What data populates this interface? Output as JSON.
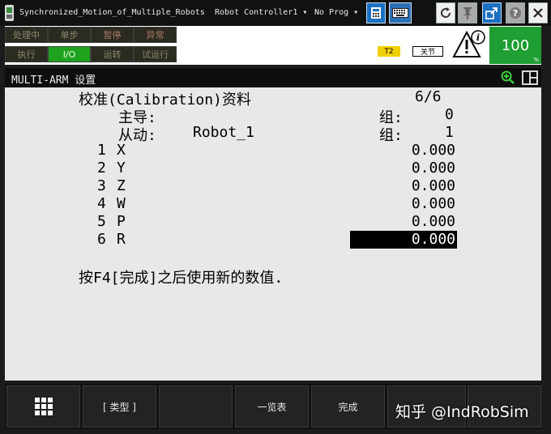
{
  "window": {
    "title": "Synchronized_Motion_of_Multiple_Robots",
    "controller": "Robot Controller1",
    "program": "No Prog"
  },
  "status_panel": {
    "row1": [
      "处理中",
      "单步",
      "暂停",
      "异常"
    ],
    "row2": [
      "执行",
      "I/O",
      "运转",
      "试运行"
    ],
    "active": "I/O",
    "mode": "T2",
    "joint_mode": "关节",
    "override": "100",
    "override_unit": "%"
  },
  "screen": {
    "title": "MULTI-ARM 设置"
  },
  "calibration": {
    "heading": "校准(Calibration)资料",
    "page": "6/6",
    "leader_label": "主导:",
    "leader_group_label": "组:",
    "leader_group": "0",
    "follower_label": "从动:",
    "follower_name": "Robot_1",
    "follower_group_label": "组:",
    "follower_group": "1",
    "rows": [
      {
        "num": "1",
        "axis": "X",
        "value": "0.000"
      },
      {
        "num": "2",
        "axis": "Y",
        "value": "0.000"
      },
      {
        "num": "3",
        "axis": "Z",
        "value": "0.000"
      },
      {
        "num": "4",
        "axis": "W",
        "value": "0.000"
      },
      {
        "num": "5",
        "axis": "P",
        "value": "0.000"
      },
      {
        "num": "6",
        "axis": "R",
        "value": "0.000"
      }
    ],
    "selected_row": 6,
    "instruction": "按F4[完成]之后使用新的数值."
  },
  "function_keys": {
    "f1": "[ 类型 ]",
    "f2": "",
    "f3": "一览表",
    "f4": "完成",
    "watermark": "知乎 @IndRobSim"
  },
  "icons": [
    "teach-pendant-icon",
    "dropdown-icon",
    "calculator-icon",
    "keyboard-icon",
    "refresh-icon",
    "pin-icon",
    "external-window-icon",
    "help-icon",
    "close-icon",
    "warning-info-icon",
    "zoom-in-icon",
    "split-screen-icon",
    "menu-grid-icon"
  ]
}
